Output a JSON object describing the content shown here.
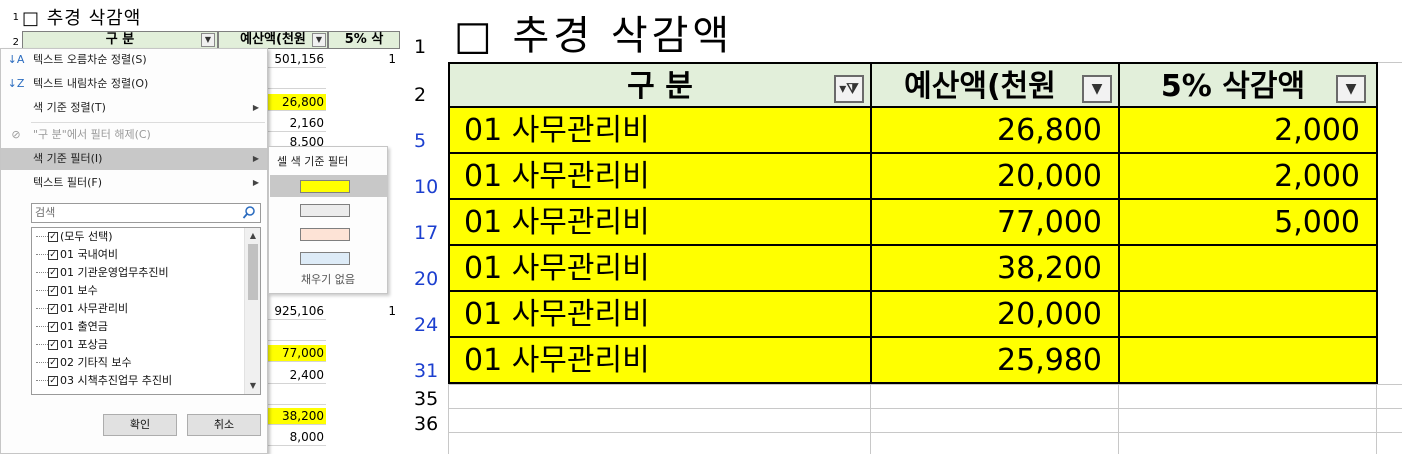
{
  "left": {
    "title": "□ 추경 삭감액",
    "row_numbers": [
      "1",
      "2"
    ],
    "headers": {
      "category": "구  분",
      "budget": "예산액(천원",
      "cut": "5% 삭"
    },
    "values": [
      "501,156",
      "",
      "26,800",
      "2,160",
      "8,500",
      "925,106",
      "",
      "77,000",
      "2,400",
      "",
      "38,200",
      "8,000"
    ],
    "cut_values": [
      "1",
      "1"
    ],
    "menu": {
      "sort_asc": "텍스트 오름차순 정렬(S)",
      "sort_desc": "텍스트 내림차순 정렬(O)",
      "sort_color": "색 기준 정렬(T)",
      "clear_filter": "\"구  분\"에서 필터 해제(C)",
      "color_filter": "색 기준 필터(I)",
      "text_filter": "텍스트 필터(F)",
      "search_placeholder": "검색",
      "checklist": [
        "(모두 선택)",
        "01 국내여비",
        "01 기관운영업무추진비",
        "01 보수",
        "01 사무관리비",
        "01 출연금",
        "01 포상금",
        "02 기타직 보수",
        "03 시책추진업무 추진비"
      ],
      "ok": "확인",
      "cancel": "취소"
    },
    "submenu": {
      "title": "셀 색 기준 필터",
      "swatches": [
        "#ffff00",
        "#ececec",
        "#fde3d6",
        "#ddebf7"
      ],
      "no_fill": "채우기 없음"
    }
  },
  "right": {
    "title": "□ 추경 삭감액",
    "row_numbers": {
      "title_row": "1",
      "header_row": "2",
      "data_rows": [
        "5",
        "10",
        "17",
        "20",
        "24",
        "31"
      ],
      "empty_rows": [
        "35",
        "36"
      ]
    },
    "headers": {
      "category": "구   분",
      "budget": "예산액(천원",
      "cut": "5% 삭감액"
    },
    "rows": [
      {
        "category": "01 사무관리비",
        "budget": "26,800",
        "cut": "2,000"
      },
      {
        "category": "01 사무관리비",
        "budget": "20,000",
        "cut": "2,000"
      },
      {
        "category": "01 사무관리비",
        "budget": "77,000",
        "cut": "5,000"
      },
      {
        "category": "01 사무관리비",
        "budget": "38,200",
        "cut": ""
      },
      {
        "category": "01 사무관리비",
        "budget": "20,000",
        "cut": ""
      },
      {
        "category": "01 사무관리비",
        "budget": "25,980",
        "cut": ""
      }
    ],
    "colors": {
      "highlight": "#ffff00",
      "header_bg": "#e2efda",
      "filtered_row_number": "#1c3fcf"
    }
  }
}
